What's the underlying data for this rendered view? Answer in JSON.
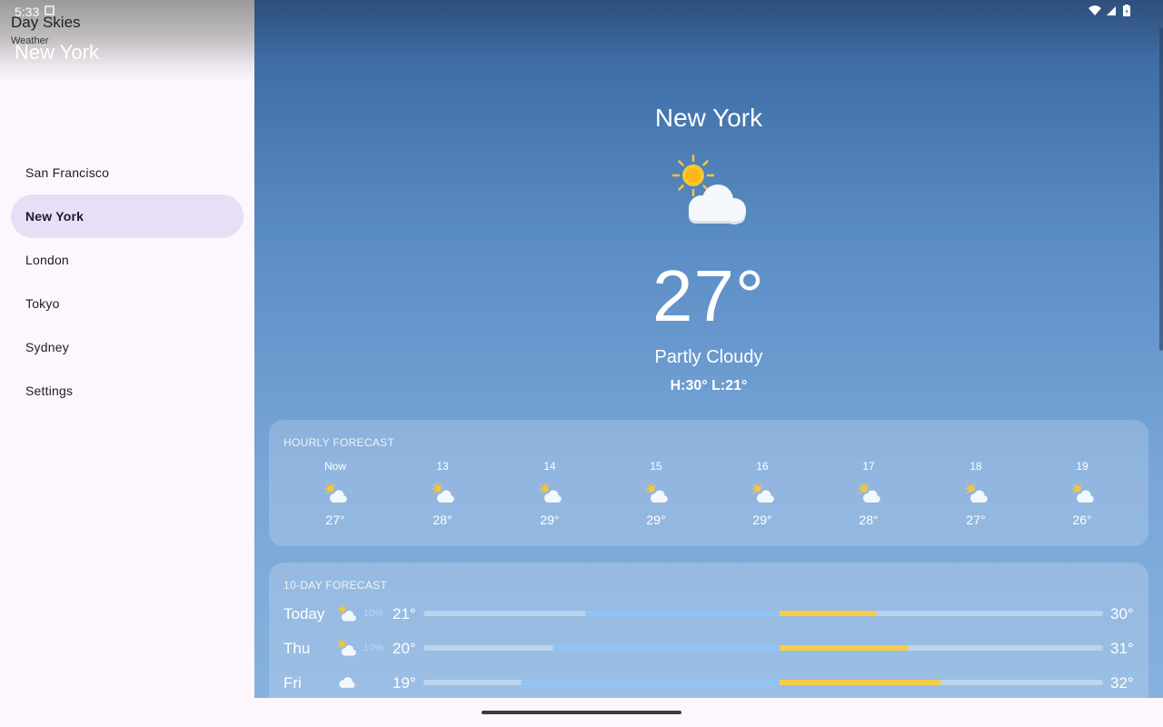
{
  "status_bar": {
    "time": "5:33"
  },
  "drawer": {
    "app_title": "Day Skies",
    "app_subtitle": "Weather",
    "current_city": "New York",
    "items": [
      {
        "label": "San Francisco"
      },
      {
        "label": "New York"
      },
      {
        "label": "London"
      },
      {
        "label": "Tokyo"
      },
      {
        "label": "Sydney"
      },
      {
        "label": "Settings"
      }
    ],
    "active_index": 1
  },
  "current": {
    "city": "New York",
    "icon": "partly-cloudy-icon",
    "temperature": "27°",
    "condition": "Partly Cloudy",
    "high_low": "H:30° L:21°"
  },
  "hourly": {
    "title": "HOURLY FORECAST",
    "items": [
      {
        "label": "Now",
        "temp": "27°",
        "icon": "partly-cloudy-icon"
      },
      {
        "label": "13",
        "temp": "28°",
        "icon": "partly-cloudy-icon"
      },
      {
        "label": "14",
        "temp": "29°",
        "icon": "partly-cloudy-icon"
      },
      {
        "label": "15",
        "temp": "29°",
        "icon": "partly-cloudy-icon"
      },
      {
        "label": "16",
        "temp": "29°",
        "icon": "partly-cloudy-icon"
      },
      {
        "label": "17",
        "temp": "28°",
        "icon": "partly-cloudy-icon"
      },
      {
        "label": "18",
        "temp": "27°",
        "icon": "partly-cloudy-icon"
      },
      {
        "label": "19",
        "temp": "26°",
        "icon": "partly-cloudy-icon"
      }
    ]
  },
  "daily": {
    "title": "10-DAY FORECAST",
    "range_min": 16,
    "range_max": 37,
    "items": [
      {
        "day": "Today",
        "icon": "partly-cloudy-icon",
        "pop": "10%",
        "low": "21°",
        "high": "30°",
        "low_value": 21,
        "high_value": 30
      },
      {
        "day": "Thu",
        "icon": "partly-cloudy-icon",
        "pop": "10%",
        "low": "20°",
        "high": "31°",
        "low_value": 20,
        "high_value": 31
      },
      {
        "day": "Fri",
        "icon": "cloudy-icon",
        "pop": "",
        "low": "19°",
        "high": "32°",
        "low_value": 19,
        "high_value": 32
      }
    ]
  },
  "colors": {
    "active_nav": "#e8def6",
    "temp_bar_cool": "#92c3f8",
    "temp_bar_warm": "#f6cd4a",
    "sun": "#f8c630",
    "precip_text": "#b8d6ff"
  }
}
